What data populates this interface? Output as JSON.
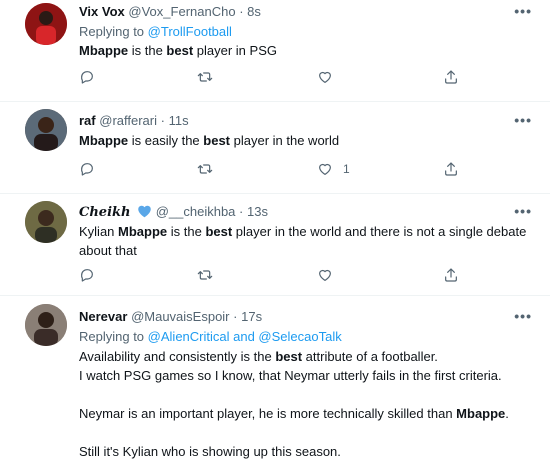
{
  "tweets": [
    {
      "name": "Vix Vox",
      "handle": "@Vox_FernanCho",
      "time": "8s",
      "reply_prefix": "Replying to",
      "reply_to": "@TrollFootball",
      "text_parts": [
        "Mbappe",
        " is the ",
        "best",
        " player in PSG"
      ],
      "likes": "",
      "colors": {
        "avatar": "#b71c1c"
      }
    },
    {
      "name": "raf",
      "handle": "@rafferari",
      "time": "11s",
      "text_parts": [
        "Mbappe",
        " is easily the ",
        "best",
        " player in the world"
      ],
      "likes": "1",
      "colors": {
        "avatar": "#3a2a24"
      }
    },
    {
      "name": "Cheikh",
      "badge": "blue-heart-icon",
      "handle": "@__cheikhba",
      "time": "13s",
      "text_parts": [
        "Kylian ",
        "Mbappe",
        " is the ",
        "best",
        " player in the world and there is not a single debate about that"
      ],
      "likes": "",
      "colors": {
        "avatar": "#5d5a3a"
      }
    },
    {
      "name": "Nerevar",
      "handle": "@MauvaisEspoir",
      "time": "17s",
      "reply_prefix": "Replying to",
      "reply_to": "@AlienCritical and @SelecaoTalk",
      "text": {
        "p1_parts": [
          "Availability and consistently is the ",
          "best",
          " attribute of a footballer."
        ],
        "p2": "I watch PSG games so I know, that Neymar utterly fails in the first criteria.",
        "p3_parts": [
          "Neymar is an important player, he is more technically skilled than ",
          "Mbappe",
          "."
        ],
        "p4": "Still it's Kylian who is showing up this season."
      },
      "colors": {
        "avatar": "#6a5a52"
      }
    }
  ],
  "icons": {
    "more": "more-icon",
    "reply": "reply-icon",
    "retweet": "retweet-icon",
    "like": "like-icon",
    "share": "share-icon"
  },
  "colors": {
    "link": "#1d9bf0",
    "secondary": "#536471",
    "text": "#0f1419"
  },
  "more_glyph": "•••"
}
